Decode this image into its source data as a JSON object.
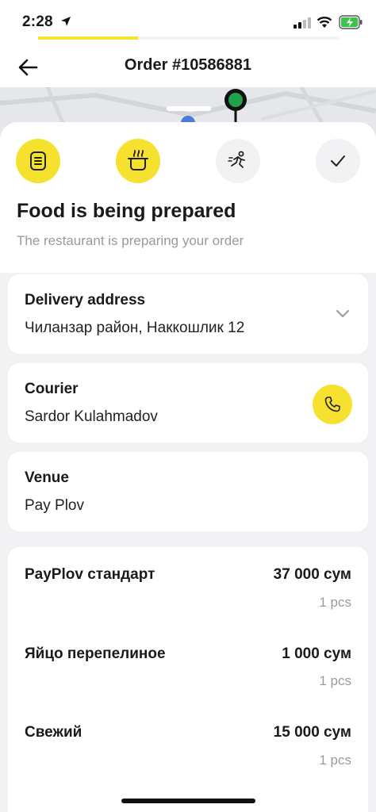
{
  "status_bar": {
    "time": "2:28"
  },
  "nav": {
    "title": "Order #10586881"
  },
  "order_status": {
    "title": "Food is being prepared",
    "subtitle": "The restaurant is preparing your order",
    "steps": [
      {
        "icon": "receipt-icon",
        "state": "done"
      },
      {
        "icon": "cooking-pot-icon",
        "state": "active"
      },
      {
        "icon": "running-courier-icon",
        "state": "pending"
      },
      {
        "icon": "checkmark-icon",
        "state": "pending"
      }
    ]
  },
  "delivery": {
    "label": "Delivery address",
    "value": "Чиланзар район, Наккошлик 12"
  },
  "courier": {
    "label": "Courier",
    "value": "Sardor Kulahmadov"
  },
  "venue": {
    "label": "Venue",
    "value": "Pay Plov"
  },
  "items": [
    {
      "name": "PayPlov  стандарт",
      "price": "37 000 сум",
      "qty": "1 pcs"
    },
    {
      "name": "Яйцо перепелиное",
      "price": "1 000 сум",
      "qty": "1 pcs"
    },
    {
      "name": "Свежий",
      "price": "15 000 сум",
      "qty": "1 pcs"
    }
  ],
  "colors": {
    "accent": "#f6e12e",
    "map_pin": "#1fa34a"
  }
}
